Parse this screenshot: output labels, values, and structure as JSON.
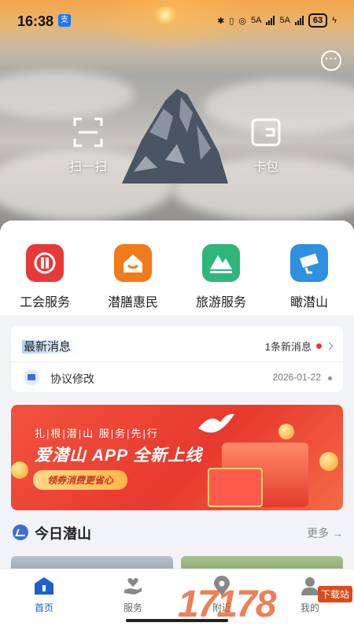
{
  "status_bar": {
    "time": "16:38",
    "app_badge": "支",
    "signal_1": "5A",
    "signal_2": "5A",
    "battery": "63"
  },
  "hero": {
    "scan_label": "扫一扫",
    "wallet_label": "卡包",
    "icons": {
      "scan": "scan-icon",
      "wallet": "wallet-icon",
      "message": "message-icon"
    }
  },
  "quick_services": [
    {
      "label": "工会服务",
      "icon": "union-icon",
      "color": "#e8393a"
    },
    {
      "label": "潜膳惠民",
      "icon": "house-smile-icon",
      "color": "#f07a1c"
    },
    {
      "label": "旅游服务",
      "icon": "mountain-icon",
      "color": "#2fb67a"
    },
    {
      "label": "瞰潜山",
      "icon": "camera-icon",
      "color": "#2f8fe0"
    }
  ],
  "news": {
    "title": "最新消息",
    "count_label": "1条新消息",
    "item_text": "协议修改",
    "item_date": "2026-01-22"
  },
  "banner": {
    "slogan": "扎|根|潜|山   服|务|先|行",
    "title": "爱潜山 APP 全新上线",
    "pill": "领券消费更省心"
  },
  "today": {
    "title": "今日潜山",
    "more": "更多 →"
  },
  "tabbar": [
    {
      "label": "首页",
      "icon": "home-icon",
      "active": true
    },
    {
      "label": "服务",
      "icon": "heart-hand-icon",
      "active": false
    },
    {
      "label": "附近",
      "icon": "location-icon",
      "active": false
    },
    {
      "label": "我的",
      "icon": "person-icon",
      "active": false
    }
  ],
  "watermark": {
    "number": "17178",
    "badge": "下载站"
  },
  "colors": {
    "accent": "#1f5fd1",
    "banner_red": "#e8392e",
    "background": "#f2f3f7"
  }
}
